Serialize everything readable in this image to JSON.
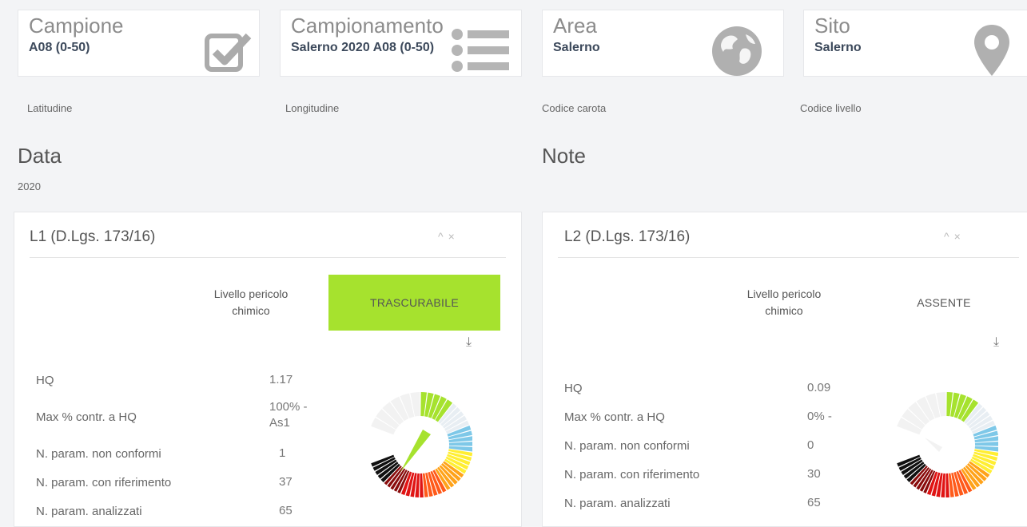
{
  "stats": [
    {
      "title": "Campione",
      "value": "A08 (0-50)",
      "icon": "checkbox-icon"
    },
    {
      "title": "Campionamento",
      "value": "Salerno 2020 A08 (0-50)",
      "icon": "list-icon"
    },
    {
      "title": "Area",
      "value": "Salerno",
      "icon": "globe-icon"
    },
    {
      "title": "Sito",
      "value": "Salerno",
      "icon": "map-pin-icon"
    }
  ],
  "fields": {
    "latitudine": "Latitudine",
    "longitudine": "Longitudine",
    "codice_carota": "Codice carota",
    "codice_livello": "Codice livello",
    "data_label": "Data",
    "data_value": "2020",
    "note_label": "Note"
  },
  "panels": [
    {
      "title": "L1 (D.Lgs. 173/16)",
      "tools": {
        "collapse": "^",
        "close": "×"
      },
      "livello_label": "Livello pericolo chimico",
      "livello_value": "TRASCURABILE",
      "livello_color": "#a6e22e",
      "rows": [
        {
          "label": "HQ",
          "value": "1.17"
        },
        {
          "label": "Max % contr. a HQ",
          "value": "100% - As1"
        },
        {
          "label": "N. param. non conformi",
          "value": "1"
        },
        {
          "label": "N. param. con riferimento",
          "value": "37"
        },
        {
          "label": "N. param. analizzati",
          "value": "65"
        }
      ],
      "gauge_level": "TRASCURABILE"
    },
    {
      "title": "L2 (D.Lgs. 173/16)",
      "tools": {
        "collapse": "^",
        "close": "×"
      },
      "livello_label": "Livello pericolo chimico",
      "livello_value": "ASSENTE",
      "livello_color": "#ffffff",
      "rows": [
        {
          "label": "HQ",
          "value": "0.09"
        },
        {
          "label": "Max % contr. a HQ",
          "value": "0% -"
        },
        {
          "label": "N. param. non conformi",
          "value": "0"
        },
        {
          "label": "N. param. con riferimento",
          "value": "30"
        },
        {
          "label": "N. param. analizzati",
          "value": "65"
        }
      ],
      "gauge_level": "ASSENTE"
    }
  ],
  "gauge_colors": [
    "#f2f2f2",
    "#a6e22e",
    "#e8eef3",
    "#7ec8e8",
    "#ffee33",
    "#ffa31a",
    "#ff5a1a",
    "#e01414",
    "#8a0d0d",
    "#111111"
  ]
}
